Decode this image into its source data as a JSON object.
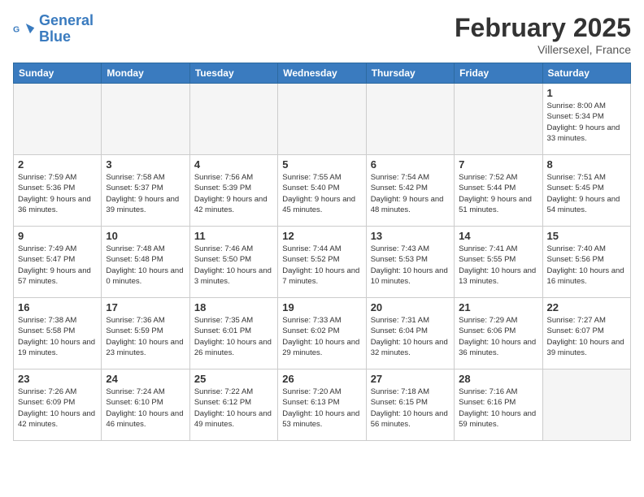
{
  "header": {
    "logo_general": "General",
    "logo_blue": "Blue",
    "month": "February 2025",
    "location": "Villersexel, France"
  },
  "weekdays": [
    "Sunday",
    "Monday",
    "Tuesday",
    "Wednesday",
    "Thursday",
    "Friday",
    "Saturday"
  ],
  "weeks": [
    [
      {
        "day": "",
        "info": ""
      },
      {
        "day": "",
        "info": ""
      },
      {
        "day": "",
        "info": ""
      },
      {
        "day": "",
        "info": ""
      },
      {
        "day": "",
        "info": ""
      },
      {
        "day": "",
        "info": ""
      },
      {
        "day": "1",
        "info": "Sunrise: 8:00 AM\nSunset: 5:34 PM\nDaylight: 9 hours and 33 minutes."
      }
    ],
    [
      {
        "day": "2",
        "info": "Sunrise: 7:59 AM\nSunset: 5:36 PM\nDaylight: 9 hours and 36 minutes."
      },
      {
        "day": "3",
        "info": "Sunrise: 7:58 AM\nSunset: 5:37 PM\nDaylight: 9 hours and 39 minutes."
      },
      {
        "day": "4",
        "info": "Sunrise: 7:56 AM\nSunset: 5:39 PM\nDaylight: 9 hours and 42 minutes."
      },
      {
        "day": "5",
        "info": "Sunrise: 7:55 AM\nSunset: 5:40 PM\nDaylight: 9 hours and 45 minutes."
      },
      {
        "day": "6",
        "info": "Sunrise: 7:54 AM\nSunset: 5:42 PM\nDaylight: 9 hours and 48 minutes."
      },
      {
        "day": "7",
        "info": "Sunrise: 7:52 AM\nSunset: 5:44 PM\nDaylight: 9 hours and 51 minutes."
      },
      {
        "day": "8",
        "info": "Sunrise: 7:51 AM\nSunset: 5:45 PM\nDaylight: 9 hours and 54 minutes."
      }
    ],
    [
      {
        "day": "9",
        "info": "Sunrise: 7:49 AM\nSunset: 5:47 PM\nDaylight: 9 hours and 57 minutes."
      },
      {
        "day": "10",
        "info": "Sunrise: 7:48 AM\nSunset: 5:48 PM\nDaylight: 10 hours and 0 minutes."
      },
      {
        "day": "11",
        "info": "Sunrise: 7:46 AM\nSunset: 5:50 PM\nDaylight: 10 hours and 3 minutes."
      },
      {
        "day": "12",
        "info": "Sunrise: 7:44 AM\nSunset: 5:52 PM\nDaylight: 10 hours and 7 minutes."
      },
      {
        "day": "13",
        "info": "Sunrise: 7:43 AM\nSunset: 5:53 PM\nDaylight: 10 hours and 10 minutes."
      },
      {
        "day": "14",
        "info": "Sunrise: 7:41 AM\nSunset: 5:55 PM\nDaylight: 10 hours and 13 minutes."
      },
      {
        "day": "15",
        "info": "Sunrise: 7:40 AM\nSunset: 5:56 PM\nDaylight: 10 hours and 16 minutes."
      }
    ],
    [
      {
        "day": "16",
        "info": "Sunrise: 7:38 AM\nSunset: 5:58 PM\nDaylight: 10 hours and 19 minutes."
      },
      {
        "day": "17",
        "info": "Sunrise: 7:36 AM\nSunset: 5:59 PM\nDaylight: 10 hours and 23 minutes."
      },
      {
        "day": "18",
        "info": "Sunrise: 7:35 AM\nSunset: 6:01 PM\nDaylight: 10 hours and 26 minutes."
      },
      {
        "day": "19",
        "info": "Sunrise: 7:33 AM\nSunset: 6:02 PM\nDaylight: 10 hours and 29 minutes."
      },
      {
        "day": "20",
        "info": "Sunrise: 7:31 AM\nSunset: 6:04 PM\nDaylight: 10 hours and 32 minutes."
      },
      {
        "day": "21",
        "info": "Sunrise: 7:29 AM\nSunset: 6:06 PM\nDaylight: 10 hours and 36 minutes."
      },
      {
        "day": "22",
        "info": "Sunrise: 7:27 AM\nSunset: 6:07 PM\nDaylight: 10 hours and 39 minutes."
      }
    ],
    [
      {
        "day": "23",
        "info": "Sunrise: 7:26 AM\nSunset: 6:09 PM\nDaylight: 10 hours and 42 minutes."
      },
      {
        "day": "24",
        "info": "Sunrise: 7:24 AM\nSunset: 6:10 PM\nDaylight: 10 hours and 46 minutes."
      },
      {
        "day": "25",
        "info": "Sunrise: 7:22 AM\nSunset: 6:12 PM\nDaylight: 10 hours and 49 minutes."
      },
      {
        "day": "26",
        "info": "Sunrise: 7:20 AM\nSunset: 6:13 PM\nDaylight: 10 hours and 53 minutes."
      },
      {
        "day": "27",
        "info": "Sunrise: 7:18 AM\nSunset: 6:15 PM\nDaylight: 10 hours and 56 minutes."
      },
      {
        "day": "28",
        "info": "Sunrise: 7:16 AM\nSunset: 6:16 PM\nDaylight: 10 hours and 59 minutes."
      },
      {
        "day": "",
        "info": ""
      }
    ]
  ]
}
